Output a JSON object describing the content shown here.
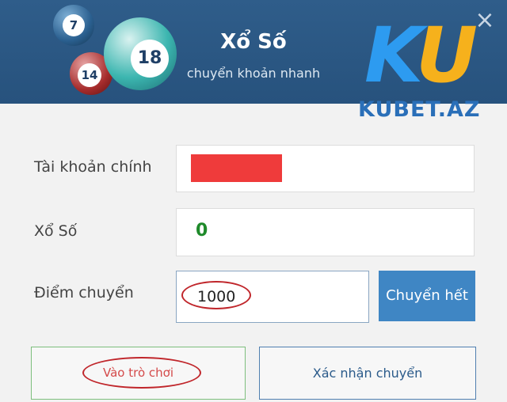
{
  "header": {
    "title": "Xổ Số",
    "subtitle": "chuyển khoản nhanh",
    "balls": [
      "7",
      "18",
      "14"
    ],
    "close_symbol": "×",
    "logo": {
      "mark_k": "K",
      "mark_u": "U",
      "text": "KUBET.AZ"
    }
  },
  "form": {
    "main_account": {
      "label": "Tài khoản chính",
      "value_hidden": true
    },
    "lottery": {
      "label": "Xổ Số",
      "value": "0"
    },
    "transfer_points": {
      "label": "Điểm chuyển",
      "value": "1000"
    },
    "transfer_all_label": "Chuyển hết"
  },
  "actions": {
    "enter_game_label": "Vào trò chơi",
    "confirm_label": "Xác nhận chuyển"
  },
  "colors": {
    "header_bg": "#2f5d8a",
    "primary_button": "#3f86c4",
    "highlight_ellipse": "#c0262b",
    "balance_green": "#1e8a2a",
    "masked_red": "#ef3b3b"
  }
}
